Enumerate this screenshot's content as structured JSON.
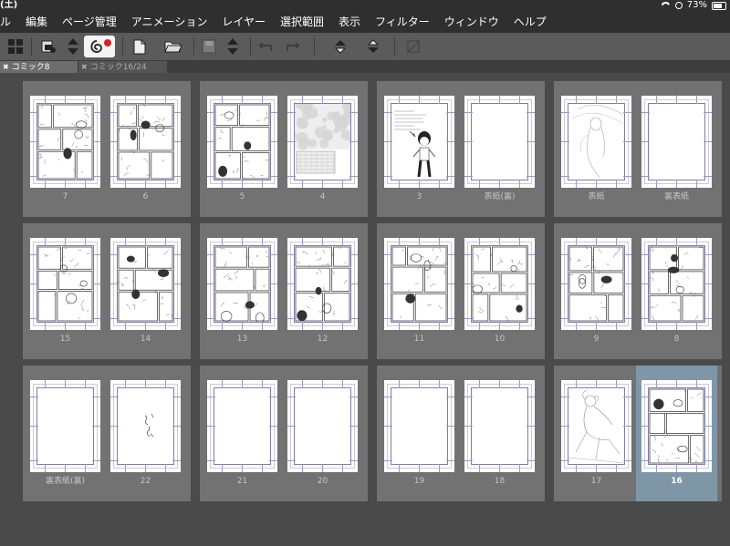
{
  "statusbar": {
    "left_fragment": "(土)",
    "battery": "73%"
  },
  "menu": {
    "items": [
      "ル",
      "編集",
      "ページ管理",
      "アニメーション",
      "レイヤー",
      "選択範囲",
      "表示",
      "フィルター",
      "ウィンドウ",
      "ヘルプ"
    ]
  },
  "toolbar": {
    "icons": [
      "grid-layout-icon",
      "page-settings-icon",
      "up-down-arrows-icon",
      "swirl-logo-icon",
      "new-document-icon",
      "open-folder-icon",
      "save-icon",
      "up-down-arrows-icon",
      "undo-icon",
      "redo-icon",
      "move-up-icon",
      "move-down-icon",
      "clear-icon"
    ],
    "accent_color": "#e02020"
  },
  "tabs": [
    {
      "label": "コミック8",
      "active": true
    },
    {
      "label": "コミック16/24",
      "active": false
    }
  ],
  "spreads": [
    [
      {
        "left": {
          "label": "7",
          "art": "sketch"
        },
        "right": {
          "label": "6",
          "art": "sketch"
        }
      },
      {
        "left": {
          "label": "5",
          "art": "sketch"
        },
        "right": {
          "label": "4",
          "art": "photo"
        }
      },
      {
        "left": {
          "label": "3",
          "art": "character"
        },
        "right": {
          "label": "表紙(裏)",
          "art": "blank"
        }
      },
      {
        "left": {
          "label": "表紙",
          "art": "cover"
        },
        "right": {
          "label": "裏表紙",
          "art": "blank"
        }
      }
    ],
    [
      {
        "left": {
          "label": "15",
          "art": "sketch"
        },
        "right": {
          "label": "14",
          "art": "sketch"
        }
      },
      {
        "left": {
          "label": "13",
          "art": "sketch"
        },
        "right": {
          "label": "12",
          "art": "sketch"
        }
      },
      {
        "left": {
          "label": "11",
          "art": "sketch"
        },
        "right": {
          "label": "10",
          "art": "sketch"
        }
      },
      {
        "left": {
          "label": "9",
          "art": "sketch"
        },
        "right": {
          "label": "8",
          "art": "sketch"
        }
      }
    ],
    [
      {
        "left": {
          "label": "裏表紙(裏)",
          "art": "blank"
        },
        "right": {
          "label": "22",
          "art": "scribble"
        }
      },
      {
        "left": {
          "label": "21",
          "art": "blank"
        },
        "right": {
          "label": "20",
          "art": "blank"
        }
      },
      {
        "left": {
          "label": "19",
          "art": "blank"
        },
        "right": {
          "label": "18",
          "art": "blank"
        }
      },
      {
        "left": {
          "label": "17",
          "art": "figure"
        },
        "right": {
          "label": "16",
          "art": "sketch",
          "selected": true
        }
      }
    ]
  ]
}
